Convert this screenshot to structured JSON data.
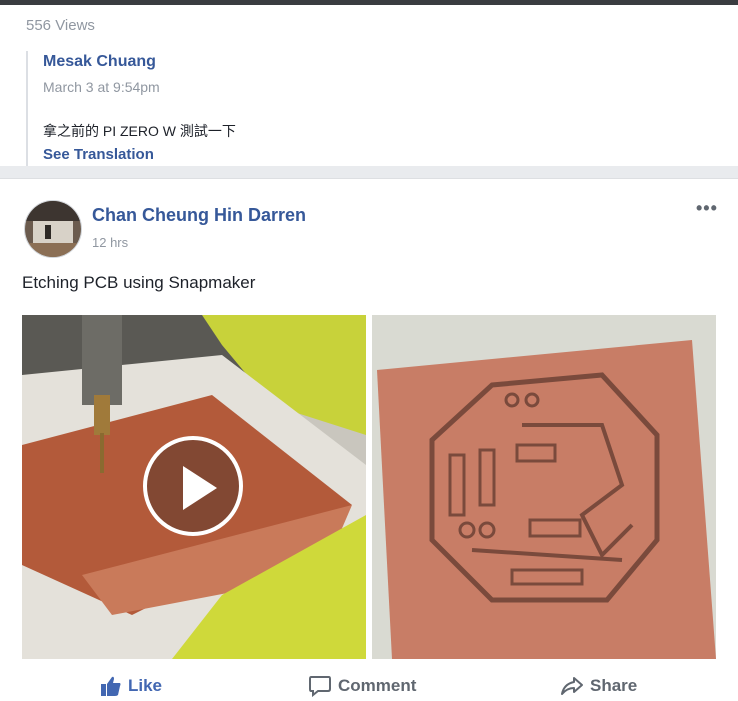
{
  "previous_post": {
    "views": "556 Views",
    "quote": {
      "author": "Mesak Chuang",
      "time": "March 3 at 9:54pm",
      "text": "拿之前的 PI ZERO W 測試一下",
      "see_translation": "See Translation"
    }
  },
  "post": {
    "author": "Chan Cheung Hin Darren",
    "time": "12 hrs",
    "more": "•••",
    "text": "Etching PCB using Snapmaker",
    "media": [
      {
        "kind": "video",
        "icon": "play-icon"
      },
      {
        "kind": "image",
        "description_icon": "pcb-board-photo"
      }
    ],
    "actions": {
      "like": "Like",
      "comment": "Comment",
      "share": "Share"
    }
  },
  "colors": {
    "link": "#365899",
    "like": "#4267b2",
    "muted": "#9097a1"
  }
}
